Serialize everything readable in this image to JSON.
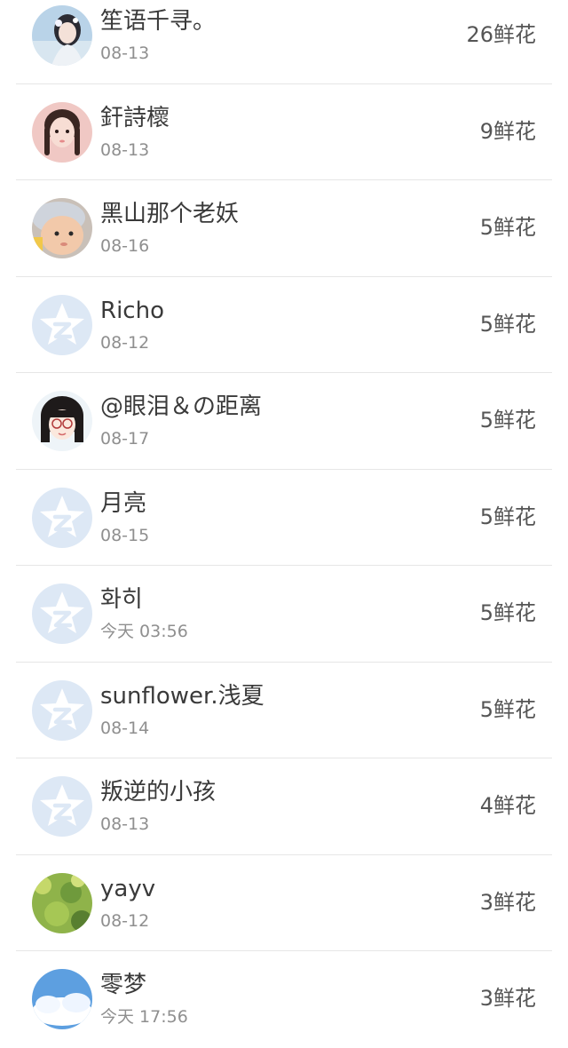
{
  "rows": [
    {
      "name": "笙语千寻。",
      "date": "08-13",
      "flowers": "26鲜花",
      "avatar": "girl-flower-avatar"
    },
    {
      "name": "釬詩櫰",
      "date": "08-13",
      "flowers": "9鲜花",
      "avatar": "girl-braids-avatar"
    },
    {
      "name": "黑山那个老妖",
      "date": "08-16",
      "flowers": "5鲜花",
      "avatar": "baby-avatar"
    },
    {
      "name": "Richo",
      "date": "08-12",
      "flowers": "5鲜花",
      "avatar": "default-qzone-avatar"
    },
    {
      "name": "@眼泪＆の距离",
      "date": "08-17",
      "flowers": "5鲜花",
      "avatar": "cartoon-girl-glasses-avatar"
    },
    {
      "name": "月亮",
      "date": "08-15",
      "flowers": "5鲜花",
      "avatar": "default-qzone-avatar"
    },
    {
      "name": "화히",
      "date": "今天 03:56",
      "flowers": "5鲜花",
      "avatar": "default-qzone-avatar"
    },
    {
      "name": "sunflower.浅夏",
      "date": "08-14",
      "flowers": "5鲜花",
      "avatar": "default-qzone-avatar"
    },
    {
      "name": "叛逆的小孩",
      "date": "08-13",
      "flowers": "4鲜花",
      "avatar": "default-qzone-avatar"
    },
    {
      "name": "yayv",
      "date": "08-12",
      "flowers": "3鲜花",
      "avatar": "green-field-avatar"
    },
    {
      "name": "零梦",
      "date": "今天 17:56",
      "flowers": "3鲜花",
      "avatar": "sky-clouds-avatar"
    }
  ],
  "colors": {
    "default_avatar_bg": "#dde8f5",
    "default_avatar_star": "#ffffff",
    "divider": "#e6e6e6"
  }
}
